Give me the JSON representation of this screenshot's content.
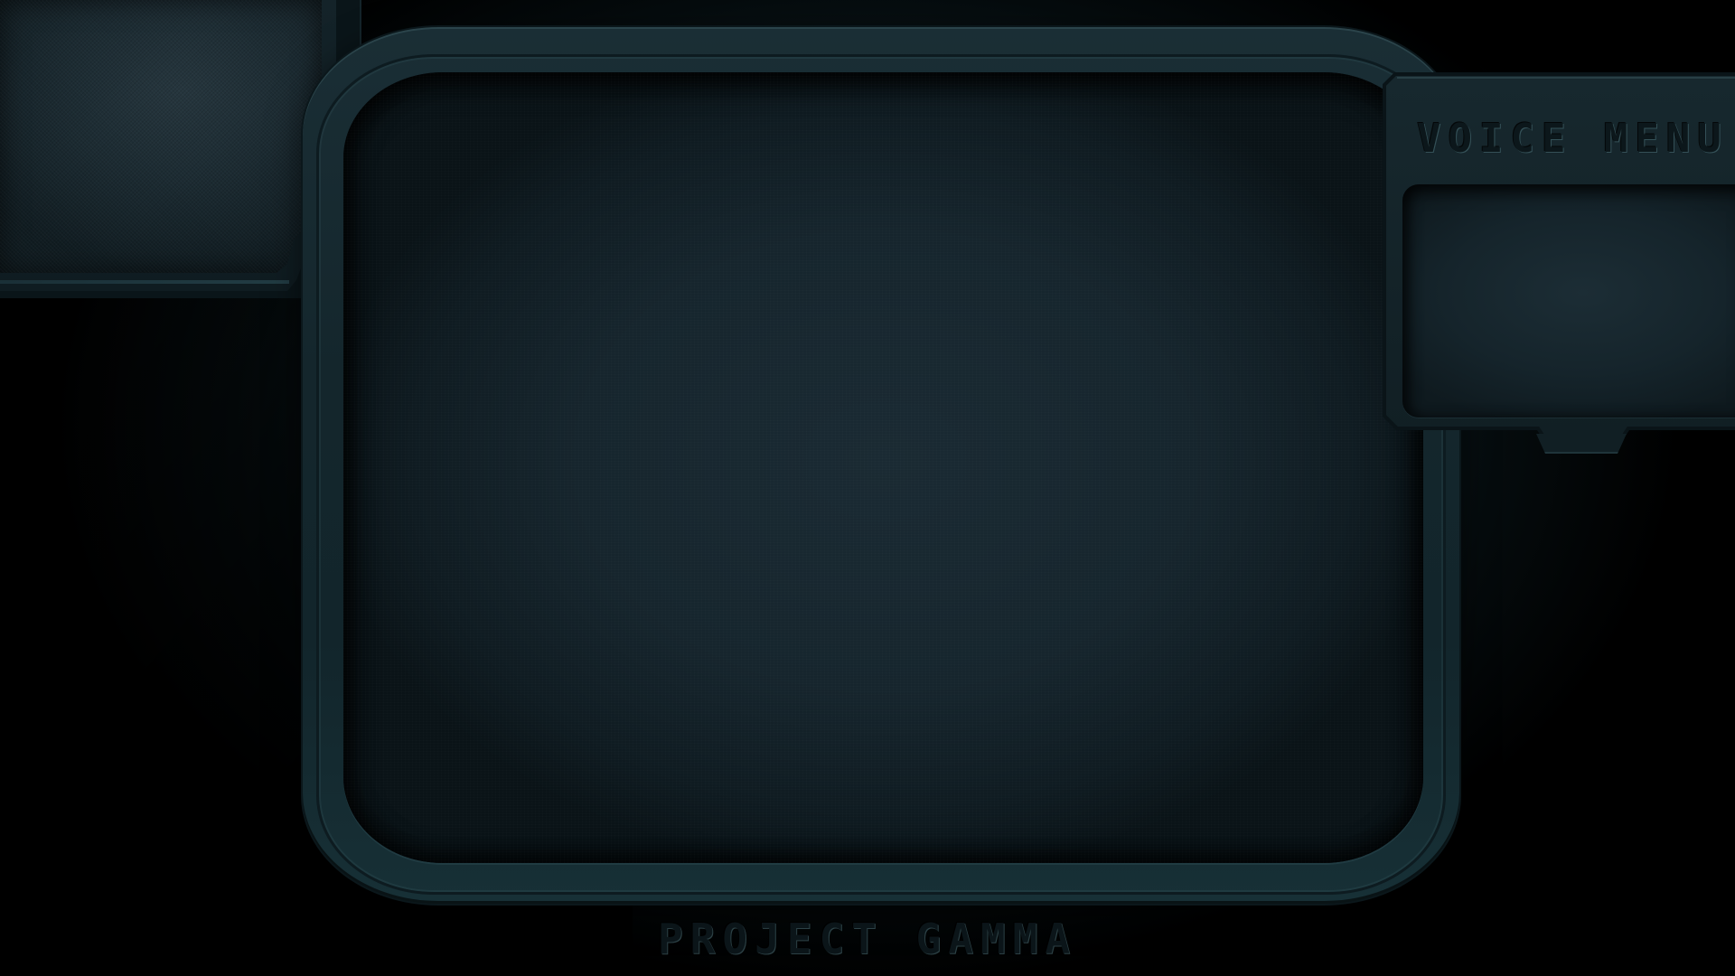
{
  "app": {
    "footer_title": "PROJECT GAMMA"
  },
  "voice_menu": {
    "title": "VOICE MENU"
  },
  "colors": {
    "background": "#000000",
    "bezel": "#14262c",
    "screen": "#16252d",
    "embossed_text": "#0b1519",
    "highlight": "#6ea0aa"
  }
}
